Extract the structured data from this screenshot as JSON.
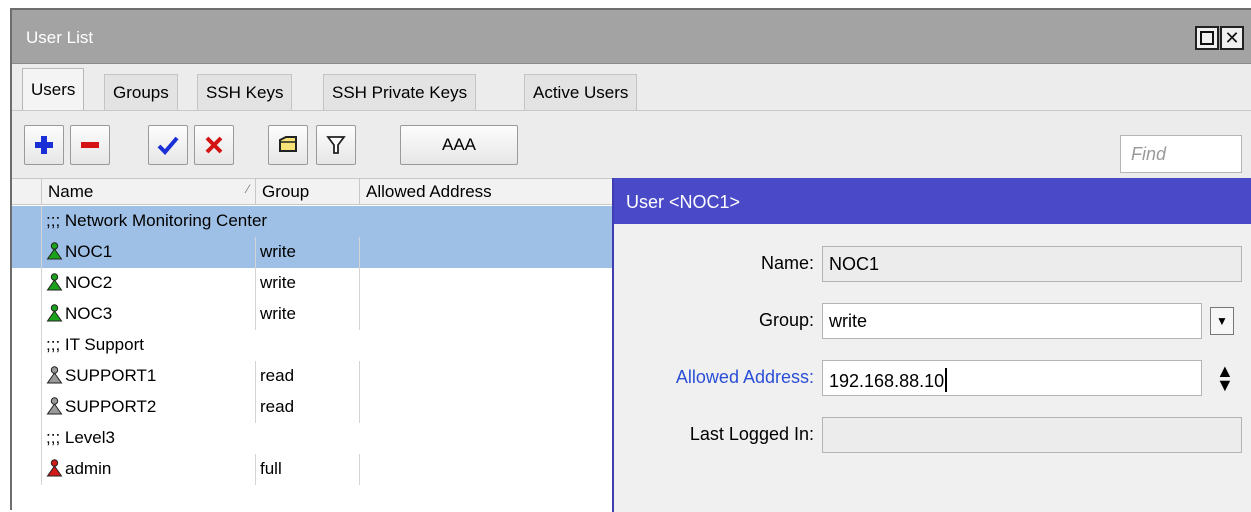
{
  "window": {
    "title": "User List"
  },
  "tabs": [
    {
      "label": "Users",
      "active": true
    },
    {
      "label": "Groups",
      "active": false
    },
    {
      "label": "SSH Keys",
      "active": false
    },
    {
      "label": "SSH Private Keys",
      "active": false
    },
    {
      "label": "Active Users",
      "active": false
    }
  ],
  "toolbar": {
    "aaa_label": "AAA",
    "find_placeholder": "Find",
    "icons": [
      "add-icon",
      "remove-icon",
      "enable-check-icon",
      "disable-x-icon",
      "comment-icon",
      "filter-icon"
    ]
  },
  "table": {
    "columns": [
      "Name",
      "Group",
      "Allowed Address"
    ],
    "rows": [
      {
        "type": "comment",
        "text": ";;; Network Monitoring Center",
        "selected": true
      },
      {
        "type": "user",
        "name": "NOC1",
        "group": "write",
        "address": "",
        "icon_color": "#1aa31a",
        "selected": true
      },
      {
        "type": "user",
        "name": "NOC2",
        "group": "write",
        "address": "",
        "icon_color": "#1aa31a",
        "selected": false
      },
      {
        "type": "user",
        "name": "NOC3",
        "group": "write",
        "address": "",
        "icon_color": "#1aa31a",
        "selected": false
      },
      {
        "type": "comment",
        "text": ";;; IT Support",
        "selected": false
      },
      {
        "type": "user",
        "name": "SUPPORT1",
        "group": "read",
        "address": "",
        "icon_color": "#9a9a9a",
        "selected": false
      },
      {
        "type": "user",
        "name": "SUPPORT2",
        "group": "read",
        "address": "",
        "icon_color": "#9a9a9a",
        "selected": false
      },
      {
        "type": "comment",
        "text": ";;; Level3",
        "selected": false
      },
      {
        "type": "user",
        "name": "admin",
        "group": "full",
        "address": "",
        "icon_color": "#d11a1a",
        "selected": false
      }
    ]
  },
  "dialog": {
    "title": "User <NOC1>",
    "fields": {
      "name_label": "Name:",
      "name_value": "NOC1",
      "group_label": "Group:",
      "group_value": "write",
      "allowed_label": "Allowed Address:",
      "allowed_value": "192.168.88.10",
      "last_label": "Last Logged In:",
      "last_value": ""
    }
  },
  "colors": {
    "selection": "#9fc0e6",
    "dialog_title": "#4a4ac8",
    "label_blue": "#2a4fd6"
  }
}
